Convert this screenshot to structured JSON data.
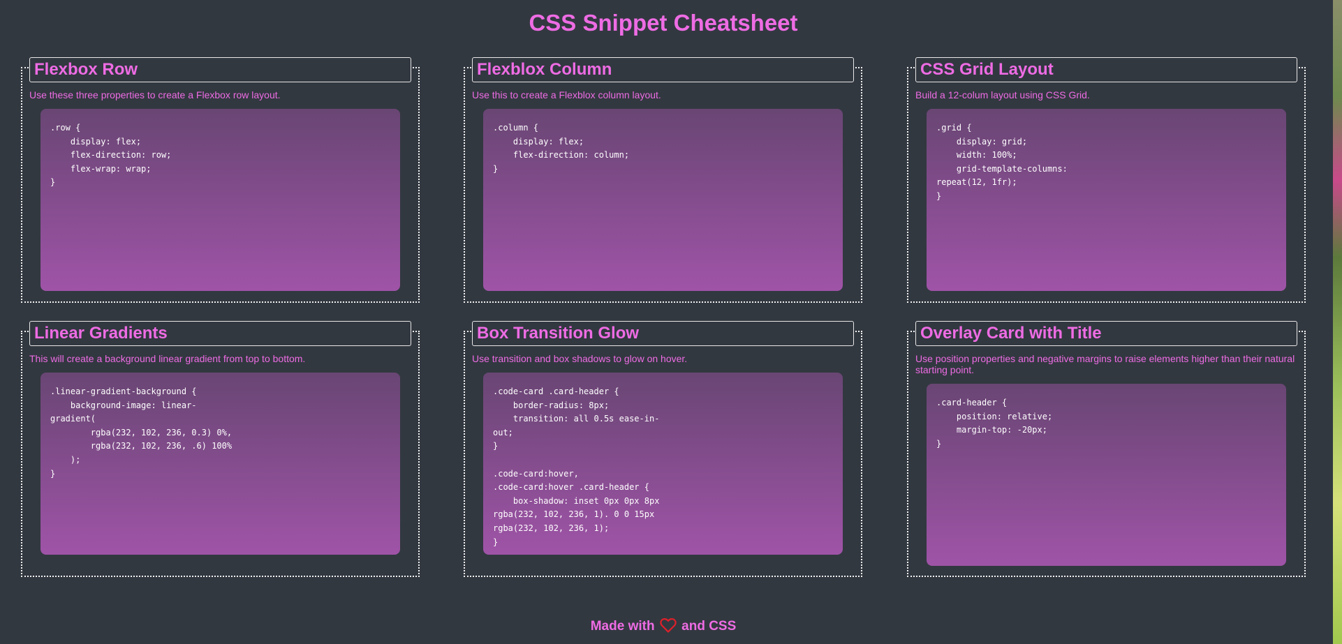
{
  "page": {
    "title": "CSS Snippet Cheatsheet"
  },
  "cards": [
    {
      "title": "Flexbox Row",
      "description": "Use these three properties to create a Flexbox row layout.",
      "code": ".row {\n    display: flex;\n    flex-direction: row;\n    flex-wrap: wrap;\n}"
    },
    {
      "title": "Flexblox Column",
      "description": "Use this to create a Flexblox column layout.",
      "code": ".column {\n    display: flex;\n    flex-direction: column;\n}"
    },
    {
      "title": "CSS Grid Layout",
      "description": "Build a 12-colum layout using CSS Grid.",
      "code": ".grid {\n    display: grid;\n    width: 100%;\n    grid-template-columns:\nrepeat(12, 1fr);\n}"
    },
    {
      "title": "Linear Gradients",
      "description": "This will create a background linear gradient from top to bottom.",
      "code": ".linear-gradient-background {\n    background-image: linear-\ngradient(\n        rgba(232, 102, 236, 0.3) 0%,\n        rgba(232, 102, 236, .6) 100%\n    );\n}"
    },
    {
      "title": "Box Transition Glow",
      "description": "Use transition and box shadows to glow on hover.",
      "code": ".code-card .card-header {\n    border-radius: 8px;\n    transition: all 0.5s ease-in-\nout;\n}\n\n.code-card:hover,\n.code-card:hover .card-header {\n    box-shadow: inset 0px 0px 8px\nrgba(232, 102, 236, 1). 0 0 15px\nrgba(232, 102, 236, 1);\n}"
    },
    {
      "title": "Overlay Card with Title",
      "description": "Use position properties and negative margins to raise elements higher than their natural starting point.",
      "code": ".card-header {\n    position: relative;\n    margin-top: -20px;\n}"
    }
  ],
  "footer": {
    "prefix": "Made with",
    "suffix": "and CSS",
    "icon": "heart-icon"
  },
  "colors": {
    "background": "#323840",
    "accent": "#ee6ce4",
    "border": "#f2f2f2",
    "heart": "#e0202a"
  }
}
